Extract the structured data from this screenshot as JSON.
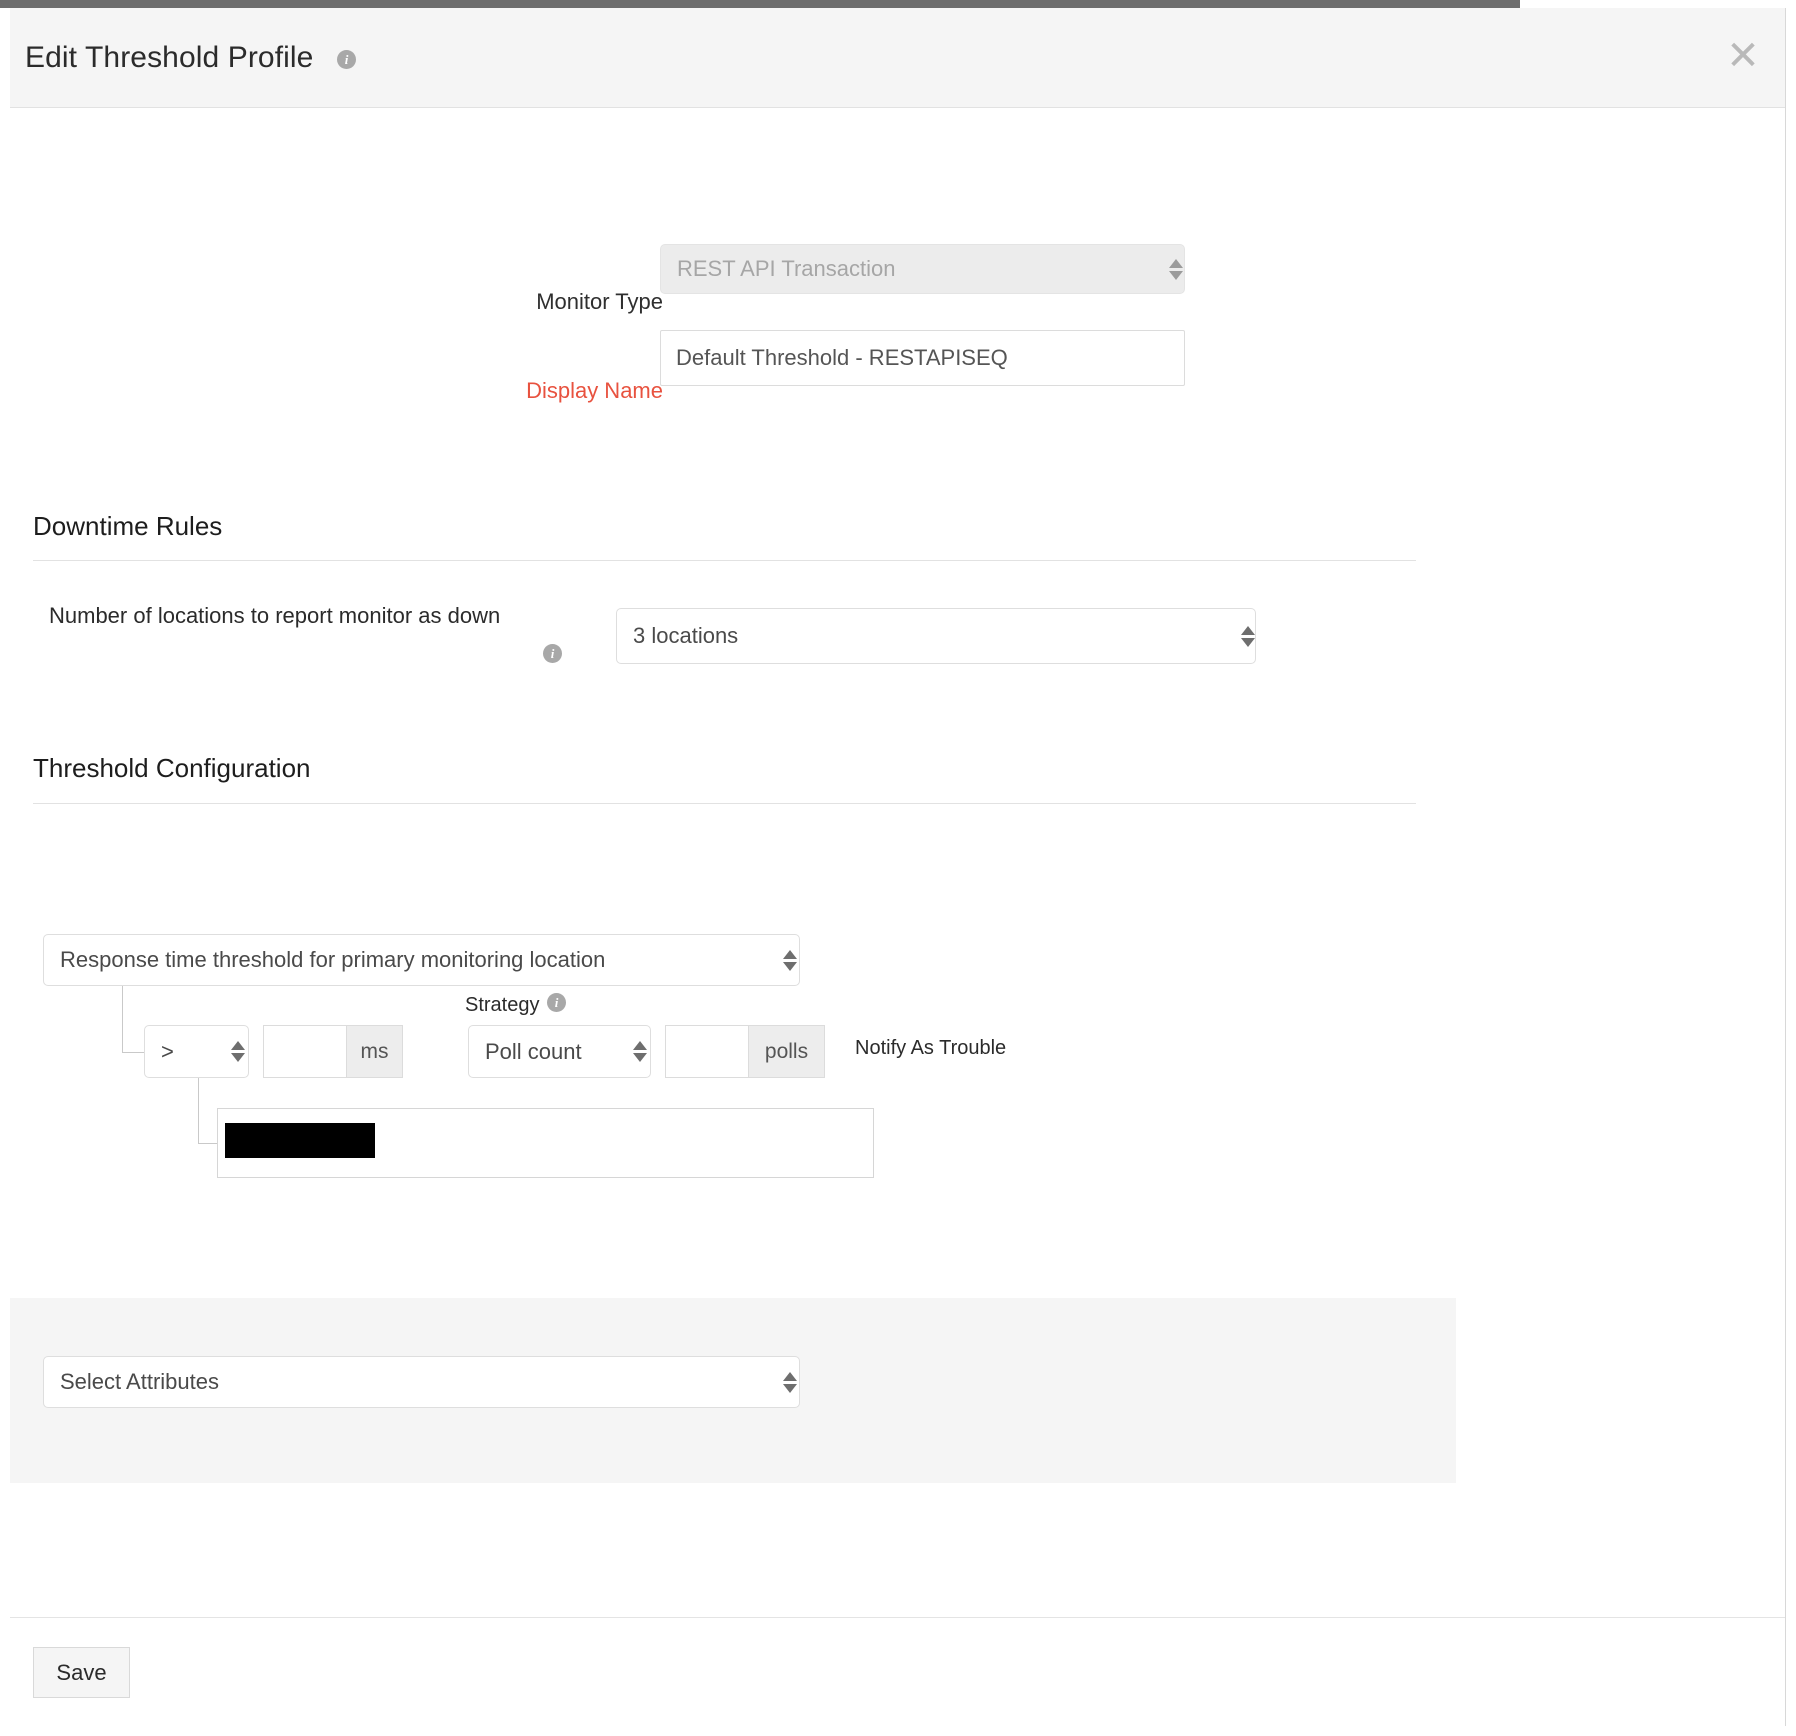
{
  "window": {
    "title": "Edit Threshold Profile",
    "title_info_icon": "info-icon",
    "close_icon": "close-icon"
  },
  "form": {
    "monitor_type": {
      "label": "Monitor Type",
      "value": "REST API Transaction",
      "disabled": true
    },
    "display_name": {
      "label": "Display Name",
      "value": "Default Threshold - RESTAPISEQ",
      "required": true
    }
  },
  "downtime_rules": {
    "heading": "Downtime Rules",
    "locations": {
      "label": "Number of locations to report monitor as down",
      "info_icon": "info-icon",
      "value": "3 locations"
    }
  },
  "threshold_configuration": {
    "heading": "Threshold Configuration",
    "rule": {
      "metric": "Response time threshold for primary monitoring location",
      "operator": ">",
      "threshold_value": "",
      "threshold_unit": "ms",
      "strategy_label": "Strategy",
      "strategy_info_icon": "info-icon",
      "strategy": "Poll count",
      "poll_value": "",
      "poll_unit": "polls",
      "notify_label": "Notify As Trouble",
      "critical_value": "",
      "critical_redacted": true
    }
  },
  "attributes": {
    "select_placeholder": "Select Attributes"
  },
  "footer": {
    "save_label": "Save"
  },
  "colors": {
    "required_label": "#e8523f",
    "header_bg": "#f5f5f5",
    "panel_bg": "#f5f5f5",
    "border": "#dedede"
  }
}
